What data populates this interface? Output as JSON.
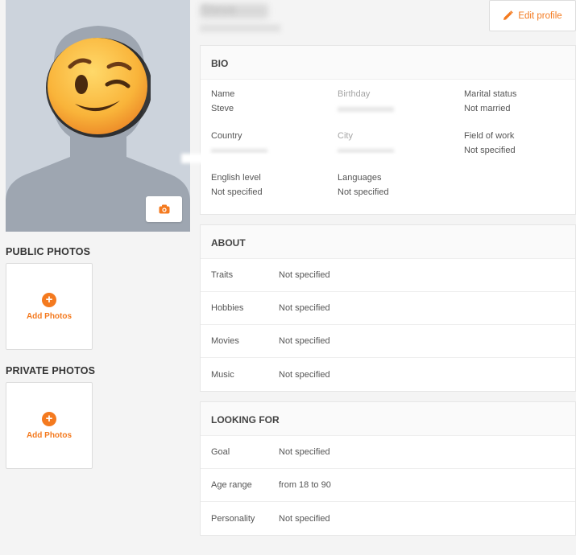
{
  "profile": {
    "edit_label": "Edit profile",
    "name_blurred": "Steve"
  },
  "photos": {
    "public_label": "PUBLIC PHOTOS",
    "private_label": "PRIVATE PHOTOS",
    "add_label": "Add Photos"
  },
  "bio": {
    "title": "BIO",
    "fields": [
      {
        "label": "Name",
        "value": "Steve"
      },
      {
        "label": "Birthday",
        "value": ""
      },
      {
        "label": "Marital status",
        "value": "Not married"
      },
      {
        "label": "Country",
        "value": ""
      },
      {
        "label": "City",
        "value": ""
      },
      {
        "label": "Field of work",
        "value": "Not specified"
      },
      {
        "label": "English level",
        "value": "Not specified"
      },
      {
        "label": "Languages",
        "value": "Not specified"
      }
    ]
  },
  "about": {
    "title": "ABOUT",
    "rows": [
      {
        "label": "Traits",
        "value": "Not specified"
      },
      {
        "label": "Hobbies",
        "value": "Not specified"
      },
      {
        "label": "Movies",
        "value": "Not specified"
      },
      {
        "label": "Music",
        "value": "Not specified"
      }
    ]
  },
  "looking_for": {
    "title": "LOOKING FOR",
    "rows": [
      {
        "label": "Goal",
        "value": "Not specified"
      },
      {
        "label": "Age range",
        "value": "from 18 to 90"
      },
      {
        "label": "Personality",
        "value": "Not specified"
      }
    ]
  },
  "colors": {
    "accent": "#f47a1f",
    "avatar_bg": "#ccd3dc",
    "page_bg": "#f4f4f4"
  },
  "icons": {
    "camera": "camera-icon",
    "edit": "pencil-icon",
    "add": "plus-circle-icon"
  }
}
